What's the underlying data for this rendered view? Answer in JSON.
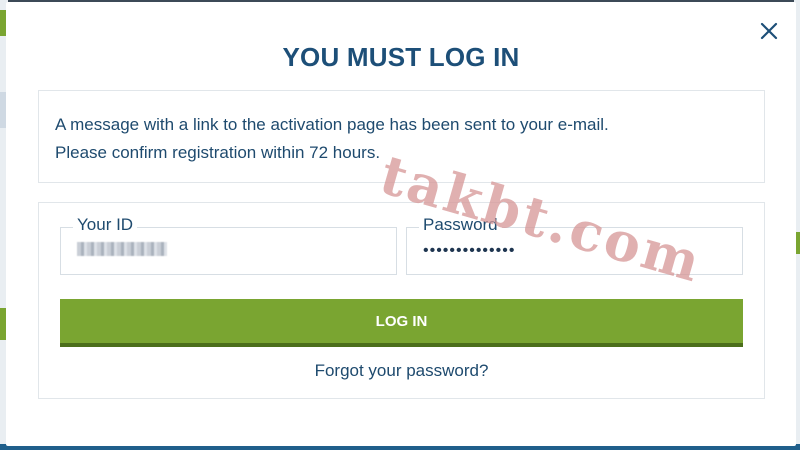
{
  "modal": {
    "title": "YOU MUST LOG IN",
    "close_icon": "close-icon",
    "message_line1": "A message with a link to the activation page has been sent to your e-mail.",
    "message_line2": "Please confirm registration within 72 hours."
  },
  "form": {
    "id_label": "Your ID",
    "password_label": "Password",
    "password_value": "••••••••••••••",
    "login_label": "LOG IN",
    "forgot_label": "Forgot your password?"
  },
  "watermark": "takbt.com",
  "colors": {
    "accent_green": "#7aa531",
    "title_blue": "#1d4f78",
    "text_blue": "#1e4a6e"
  }
}
